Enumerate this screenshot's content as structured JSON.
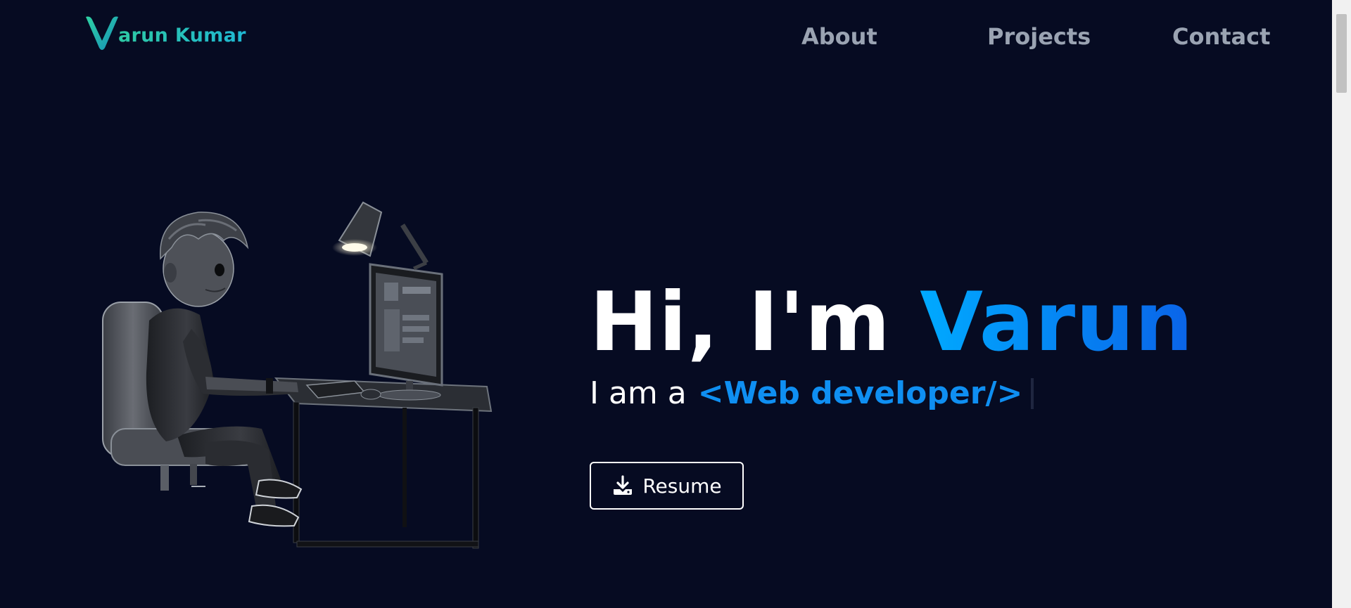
{
  "header": {
    "logo_letter": "V",
    "logo_text": "arun Kumar",
    "nav": [
      {
        "label": "About"
      },
      {
        "label": "Projects"
      },
      {
        "label": "Contact"
      }
    ]
  },
  "hero": {
    "greeting_prefix": "Hi, I'm",
    "greeting_name": "Varun",
    "tagline_prefix": "I am a",
    "role": "<Web developer/>",
    "resume_label": "Resume",
    "illustration": "3D boy coding at desk with computer and lamp"
  },
  "colors": {
    "background": "#060b22",
    "accent": "#0f8ff2",
    "logo": "#22c3b8",
    "nav_text": "#9aa3b2"
  },
  "icons": {
    "resume": "download-icon",
    "logo": "logo-v-icon"
  }
}
